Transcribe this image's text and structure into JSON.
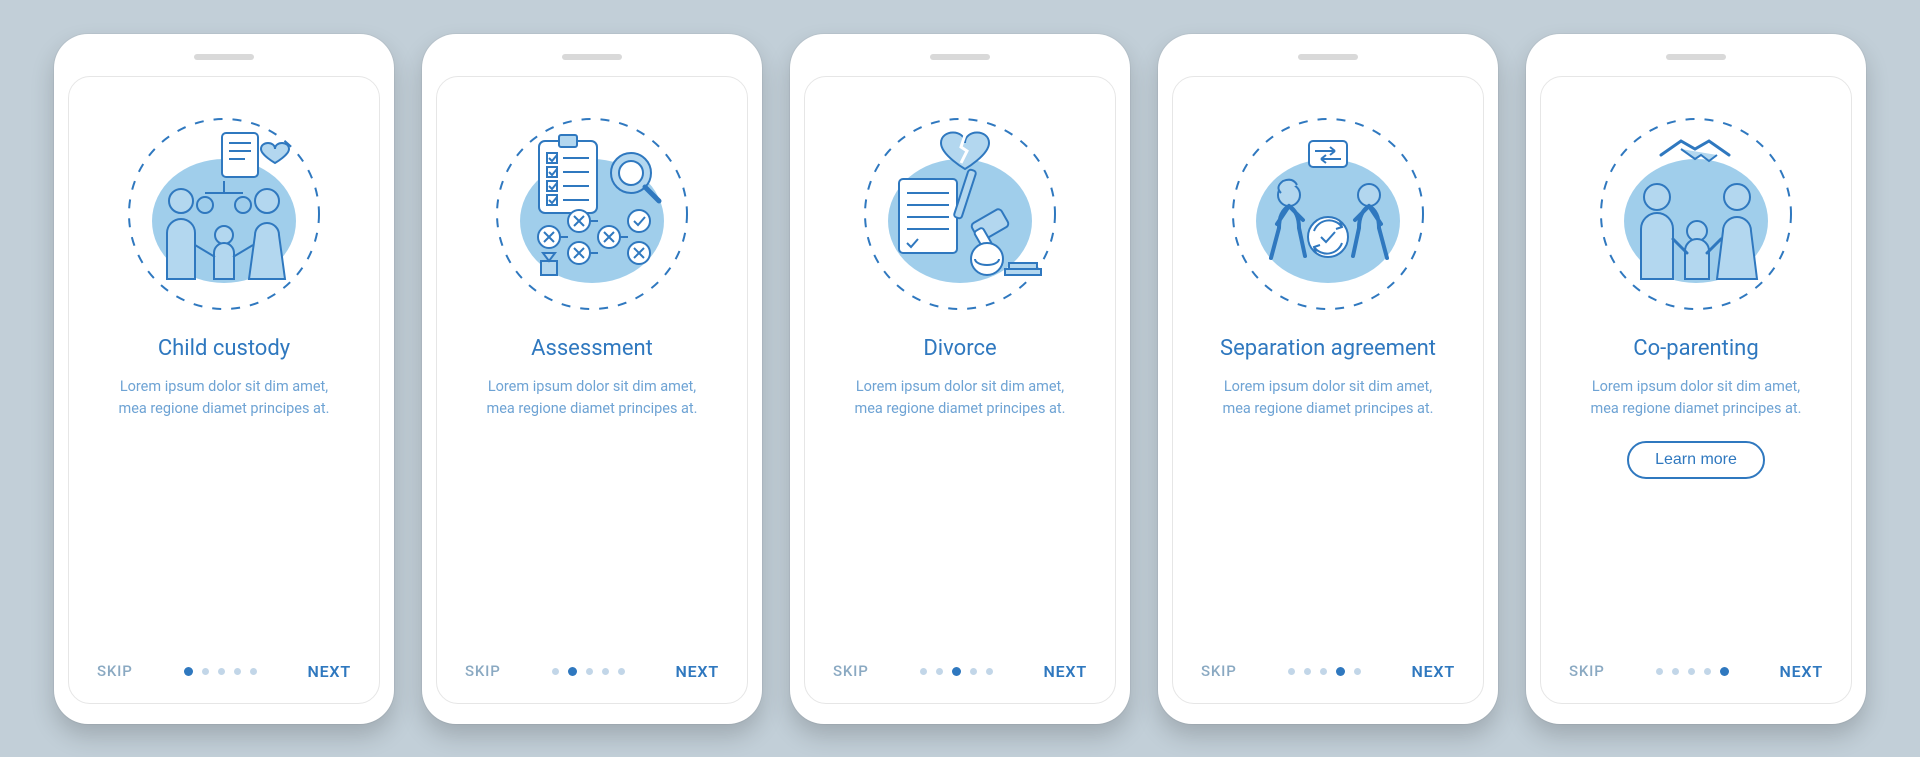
{
  "common": {
    "skip": "SKIP",
    "next": "NEXT",
    "body": "Lorem ipsum dolor sit dim amet, mea regione diamet principes at."
  },
  "screens": [
    {
      "title": "Child custody",
      "active_index": 0,
      "cta": null,
      "icon": "child-custody"
    },
    {
      "title": "Assessment",
      "active_index": 1,
      "cta": null,
      "icon": "assessment"
    },
    {
      "title": "Divorce",
      "active_index": 2,
      "cta": null,
      "icon": "divorce"
    },
    {
      "title": "Separation agreement",
      "active_index": 3,
      "cta": null,
      "icon": "separation"
    },
    {
      "title": "Co-parenting",
      "active_index": 4,
      "cta": "Learn more",
      "icon": "coparenting"
    }
  ],
  "colors": {
    "primary": "#2f78bf",
    "light": "#b3d7ef",
    "bg_blob": "#8fc6e8"
  }
}
